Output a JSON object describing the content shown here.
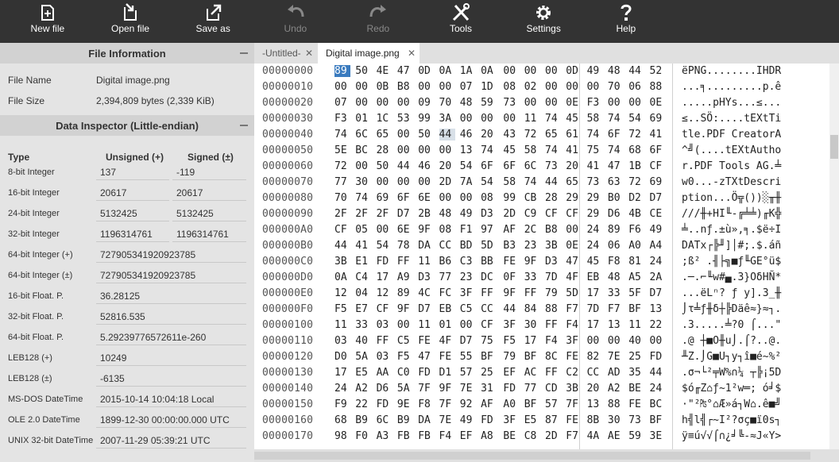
{
  "toolbar": {
    "buttons": [
      {
        "label": "New file",
        "icon": "new-file-icon"
      },
      {
        "label": "Open file",
        "icon": "open-file-icon"
      },
      {
        "label": "Save as",
        "icon": "save-as-icon"
      },
      {
        "label": "Undo",
        "icon": "undo-icon",
        "disabled": true
      },
      {
        "label": "Redo",
        "icon": "redo-icon",
        "disabled": true
      },
      {
        "label": "Tools",
        "icon": "tools-icon"
      },
      {
        "label": "Settings",
        "icon": "gear-icon"
      },
      {
        "label": "Help",
        "icon": "help-icon"
      }
    ]
  },
  "file_info": {
    "title": "File Information",
    "name_label": "File Name",
    "name_value": "Digital image.png",
    "size_label": "File Size",
    "size_value": "2,394,809 bytes (2,339 KiB)"
  },
  "inspector": {
    "title": "Data Inspector (Little-endian)",
    "col_type": "Type",
    "col_unsigned": "Unsigned (+)",
    "col_signed": "Signed (±)",
    "rows": [
      {
        "type": "8-bit Integer",
        "unsigned": "137",
        "signed": "-119"
      },
      {
        "type": "16-bit Integer",
        "unsigned": "20617",
        "signed": "20617"
      },
      {
        "type": "24-bit Integer",
        "unsigned": "5132425",
        "signed": "5132425"
      },
      {
        "type": "32-bit Integer",
        "unsigned": "1196314761",
        "signed": "1196314761"
      },
      {
        "type": "64-bit Integer (+)",
        "value": "727905341920923785"
      },
      {
        "type": "64-bit Integer (±)",
        "value": "727905341920923785"
      },
      {
        "type": "16-bit Float. P.",
        "value": "36.28125"
      },
      {
        "type": "32-bit Float. P.",
        "value": "52816.535"
      },
      {
        "type": "64-bit Float. P.",
        "value": "5.29239776572611e-260"
      },
      {
        "type": "LEB128 (+)",
        "value": "10249"
      },
      {
        "type": "LEB128 (±)",
        "value": "-6135"
      },
      {
        "type": "MS-DOS DateTime",
        "value": "2015-10-14 10:04:18 Local"
      },
      {
        "type": "OLE 2.0 DateTime",
        "value": "1899-12-30 00:00:00.000 UTC"
      },
      {
        "type": "UNIX 32-bit DateTime",
        "value": "2007-11-29 05:39:21 UTC"
      }
    ]
  },
  "tabs": [
    {
      "label": "-Untitled-",
      "active": false
    },
    {
      "label": "Digital image.png",
      "active": true
    }
  ],
  "hex": {
    "rows": [
      {
        "addr": "00000000",
        "bytes": [
          "89",
          "50",
          "4E",
          "47",
          "0D",
          "0A",
          "1A",
          "0A",
          "00",
          "00",
          "00",
          "0D",
          "49",
          "48",
          "44",
          "52"
        ],
        "text": "ëPNG........IHDR"
      },
      {
        "addr": "00000010",
        "bytes": [
          "00",
          "00",
          "0B",
          "B8",
          "00",
          "00",
          "07",
          "1D",
          "08",
          "02",
          "00",
          "00",
          "00",
          "70",
          "06",
          "88"
        ],
        "text": "...╕.........p.ê"
      },
      {
        "addr": "00000020",
        "bytes": [
          "07",
          "00",
          "00",
          "00",
          "09",
          "70",
          "48",
          "59",
          "73",
          "00",
          "00",
          "0E",
          "F3",
          "00",
          "00",
          "0E"
        ],
        "text": ".....pHYs...≤..."
      },
      {
        "addr": "00000030",
        "bytes": [
          "F3",
          "01",
          "1C",
          "53",
          "99",
          "3A",
          "00",
          "00",
          "00",
          "11",
          "74",
          "45",
          "58",
          "74",
          "54",
          "69"
        ],
        "text": "≤..SÖ:....tEXtTi"
      },
      {
        "addr": "00000040",
        "bytes": [
          "74",
          "6C",
          "65",
          "00",
          "50",
          "44",
          "46",
          "20",
          "43",
          "72",
          "65",
          "61",
          "74",
          "6F",
          "72",
          "41"
        ],
        "text": "tle.PDF CreatorA"
      },
      {
        "addr": "00000050",
        "bytes": [
          "5E",
          "BC",
          "28",
          "00",
          "00",
          "00",
          "13",
          "74",
          "45",
          "58",
          "74",
          "41",
          "75",
          "74",
          "68",
          "6F"
        ],
        "text": "^╝(....tEXtAutho"
      },
      {
        "addr": "00000060",
        "bytes": [
          "72",
          "00",
          "50",
          "44",
          "46",
          "20",
          "54",
          "6F",
          "6F",
          "6C",
          "73",
          "20",
          "41",
          "47",
          "1B",
          "CF"
        ],
        "text": "r.PDF Tools AG.╧"
      },
      {
        "addr": "00000070",
        "bytes": [
          "77",
          "30",
          "00",
          "00",
          "00",
          "2D",
          "7A",
          "54",
          "58",
          "74",
          "44",
          "65",
          "73",
          "63",
          "72",
          "69"
        ],
        "text": "w0...-zTXtDescri"
      },
      {
        "addr": "00000080",
        "bytes": [
          "70",
          "74",
          "69",
          "6F",
          "6E",
          "00",
          "00",
          "08",
          "99",
          "CB",
          "28",
          "29",
          "29",
          "B0",
          "D2",
          "D7"
        ],
        "text": "ption...Ö╦())░╥╫"
      },
      {
        "addr": "00000090",
        "bytes": [
          "2F",
          "2F",
          "2F",
          "D7",
          "2B",
          "48",
          "49",
          "D3",
          "2D",
          "C9",
          "CF",
          "CF",
          "29",
          "D6",
          "4B",
          "CE"
        ],
        "text": "///╫+HI╙-╔╧╧)╓K╬"
      },
      {
        "addr": "000000A0",
        "bytes": [
          "CF",
          "05",
          "00",
          "6E",
          "9F",
          "08",
          "F1",
          "97",
          "AF",
          "2C",
          "B8",
          "00",
          "24",
          "89",
          "F6",
          "49"
        ],
        "text": "╧..nƒ.±ù»,╕.$ë÷I"
      },
      {
        "addr": "000000B0",
        "bytes": [
          "44",
          "41",
          "54",
          "78",
          "DA",
          "CC",
          "BD",
          "5D",
          "B3",
          "23",
          "3B",
          "0E",
          "24",
          "06",
          "A0",
          "A4"
        ],
        "text": "DATx┌╠╜]│#;.$.áñ"
      },
      {
        "addr": "000000C0",
        "bytes": [
          "3B",
          "E1",
          "FD",
          "FF",
          "11",
          "B6",
          "C3",
          "BB",
          "FE",
          "9F",
          "D3",
          "47",
          "45",
          "F8",
          "81",
          "24"
        ],
        "text": ";ß² .╢├╗■ƒ╙GE°ü$"
      },
      {
        "addr": "000000D0",
        "bytes": [
          "0A",
          "C4",
          "17",
          "A9",
          "D3",
          "77",
          "23",
          "DC",
          "0F",
          "33",
          "7D",
          "4F",
          "EB",
          "48",
          "A5",
          "2A"
        ],
        "text": ".─.⌐╙w#▄.3}OδHÑ*"
      },
      {
        "addr": "000000E0",
        "bytes": [
          "12",
          "04",
          "12",
          "89",
          "4C",
          "FC",
          "3F",
          "FF",
          "9F",
          "FF",
          "79",
          "5D",
          "17",
          "33",
          "5F",
          "D7"
        ],
        "text": "...ëLⁿ? ƒ y].3_╫"
      },
      {
        "addr": "000000F0",
        "bytes": [
          "F5",
          "E7",
          "CF",
          "9F",
          "D7",
          "EB",
          "C5",
          "CC",
          "44",
          "84",
          "88",
          "F7",
          "7D",
          "F7",
          "BF",
          "13"
        ],
        "text": "⌡τ╧ƒ╫δ┼╠Däê≈}≈┐."
      },
      {
        "addr": "00000100",
        "bytes": [
          "11",
          "33",
          "03",
          "00",
          "11",
          "01",
          "00",
          "CF",
          "3F",
          "30",
          "FF",
          "F4",
          "17",
          "13",
          "11",
          "22"
        ],
        "text": ".3.....╧?0 ⌠...\""
      },
      {
        "addr": "00000110",
        "bytes": [
          "03",
          "40",
          "FF",
          "C5",
          "FE",
          "4F",
          "D7",
          "75",
          "F5",
          "17",
          "F4",
          "3F",
          "00",
          "00",
          "40",
          "00"
        ],
        "text": ".@ ┼■O╫u⌡.⌠?..@."
      },
      {
        "addr": "00000120",
        "bytes": [
          "D0",
          "5A",
          "03",
          "F5",
          "47",
          "FE",
          "55",
          "BF",
          "79",
          "BF",
          "8C",
          "FE",
          "82",
          "7E",
          "25",
          "FD"
        ],
        "text": "╨Z.⌡G■U┐y┐î■é~%²"
      },
      {
        "addr": "00000130",
        "bytes": [
          "17",
          "E5",
          "AA",
          "C0",
          "FD",
          "D1",
          "57",
          "25",
          "EF",
          "AC",
          "FF",
          "C2",
          "CC",
          "AD",
          "35",
          "44"
        ],
        "text": ".σ¬└²╤W%∩¼ ┬╠¡5D"
      },
      {
        "addr": "00000140",
        "bytes": [
          "24",
          "A2",
          "D6",
          "5A",
          "7F",
          "9F",
          "7E",
          "31",
          "FD",
          "77",
          "CD",
          "3B",
          "20",
          "A2",
          "BE",
          "24"
        ],
        "text": "$ó╓Z⌂ƒ~1²w═; ó╛$"
      },
      {
        "addr": "00000150",
        "bytes": [
          "F9",
          "22",
          "FD",
          "9E",
          "F8",
          "7F",
          "92",
          "AF",
          "A0",
          "BF",
          "57",
          "7F",
          "13",
          "88",
          "FE",
          "BC"
        ],
        "text": "·\"²₧°⌂Æ»á┐W⌂.ê■╝"
      },
      {
        "addr": "00000160",
        "bytes": [
          "68",
          "B9",
          "6C",
          "B9",
          "DA",
          "7E",
          "49",
          "FD",
          "3F",
          "E5",
          "87",
          "FE",
          "8B",
          "30",
          "73",
          "BF"
        ],
        "text": "h╣l╣┌~I²?σç■ï0s┐"
      },
      {
        "addr": "00000170",
        "bytes": [
          "98",
          "F0",
          "A3",
          "FB",
          "FB",
          "F4",
          "EF",
          "A8",
          "BE",
          "C8",
          "2D",
          "F7",
          "4A",
          "AE",
          "59",
          "3E"
        ],
        "text": "ÿ≡ú√√⌠∩¿╛╚-≈J«Y>"
      }
    ]
  }
}
